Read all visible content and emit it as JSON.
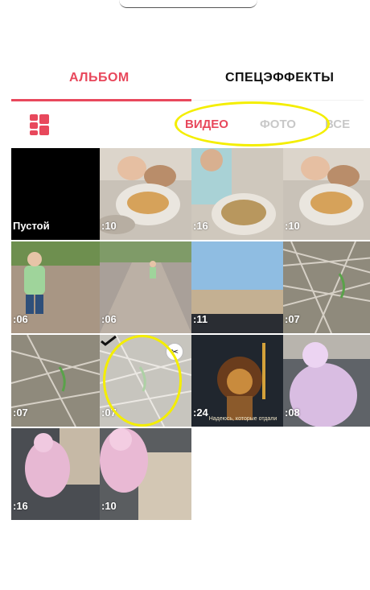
{
  "tabs": {
    "album": "АЛЬБОМ",
    "effects": "СПЕЦЭФФЕКТЫ"
  },
  "filters": {
    "video": "ВИДЕО",
    "photo": "ФОТО",
    "all": "ВСЕ"
  },
  "colors": {
    "accent": "#e8485c",
    "inactive": "#c8c8c8",
    "highlight": "#f4ee00"
  },
  "icons": {
    "layout": "layout-grid-icon",
    "check": "check-icon",
    "edit": "scissors-icon"
  },
  "grid": {
    "tiles": [
      {
        "label": "Пустой"
      },
      {
        "label": ":10"
      },
      {
        "label": ":16"
      },
      {
        "label": ":10"
      },
      {
        "label": ":06"
      },
      {
        "label": ":06"
      },
      {
        "label": ":11"
      },
      {
        "label": ":07"
      },
      {
        "label": ":07"
      },
      {
        "label": ":07"
      },
      {
        "label": ":24",
        "caption": "Надеюсь, которые отдали"
      },
      {
        "label": ":08"
      },
      {
        "label": ":16"
      },
      {
        "label": ":10"
      }
    ]
  }
}
